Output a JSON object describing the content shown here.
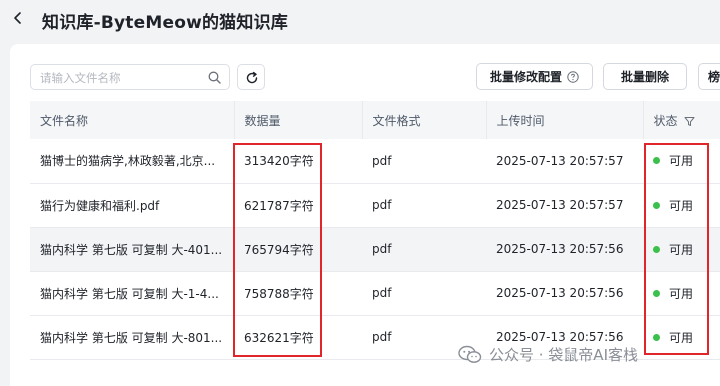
{
  "header": {
    "title": "知识库-ByteMeow的猫知识库"
  },
  "toolbar": {
    "search_placeholder": "请输入文件名称",
    "batch_config_label": "批量修改配置",
    "batch_delete_label": "批量删除",
    "more_label": "榜"
  },
  "table": {
    "columns": [
      "文件名称",
      "数据量",
      "文件格式",
      "上传时间",
      "状态"
    ],
    "rows": [
      {
        "name": "猫博士的猫病学,林政毅著,北京...",
        "size": "313420字符",
        "format": "pdf",
        "time": "2025-07-13 20:57:57",
        "status": "可用"
      },
      {
        "name": "猫行为健康和福利.pdf",
        "size": "621787字符",
        "format": "pdf",
        "time": "2025-07-13 20:57:57",
        "status": "可用"
      },
      {
        "name": "猫内科学 第七版 可复制 大-401...",
        "size": "765794字符",
        "format": "pdf",
        "time": "2025-07-13 20:57:56",
        "status": "可用"
      },
      {
        "name": "猫内科学 第七版 可复制 大-1-4...",
        "size": "758788字符",
        "format": "pdf",
        "time": "2025-07-13 20:57:56",
        "status": "可用"
      },
      {
        "name": "猫内科学 第七版 可复制 大-801...",
        "size": "632621字符",
        "format": "pdf",
        "time": "2025-07-13 20:57:56",
        "status": "可用"
      }
    ]
  },
  "watermark": {
    "text": "公众号 · 袋鼠帝AI客栈"
  },
  "colors": {
    "status_ok": "#3ac04b",
    "highlight": "#e0252b"
  }
}
